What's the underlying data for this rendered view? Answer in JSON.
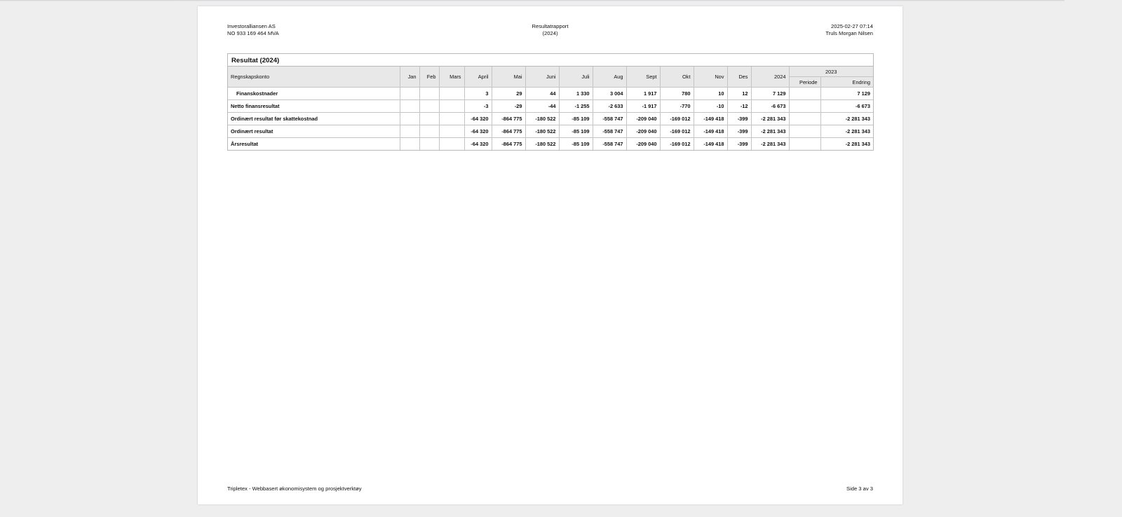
{
  "header": {
    "company": "Investoralliansen AS",
    "org_number": "NO 933 169 464 MVA",
    "report_title": "Resultatrapport",
    "report_year": "(2024)",
    "timestamp": "2025-02-27 07:14",
    "user": "Truls Morgan Nilsen"
  },
  "table": {
    "title": "Resultat (2024)",
    "columns": {
      "account": "Regnskapskonto",
      "jan": "Jan",
      "feb": "Feb",
      "mars": "Mars",
      "april": "April",
      "mai": "Mai",
      "juni": "Juni",
      "juli": "Juli",
      "aug": "Aug",
      "sept": "Sept",
      "okt": "Okt",
      "nov": "Nov",
      "des": "Des",
      "total_2024": "2024",
      "year_2023": "2023",
      "periode": "Periode",
      "endring": "Endring"
    },
    "rows": [
      {
        "label": "Finanskostnader",
        "jan": "",
        "feb": "",
        "mars": "",
        "april": "3",
        "mai": "29",
        "juni": "44",
        "juli": "1 330",
        "aug": "3 004",
        "sept": "1 917",
        "okt": "780",
        "nov": "10",
        "des": "12",
        "total": "7 129",
        "periode": "",
        "endring": "7 129"
      },
      {
        "label": "Netto finansresultat",
        "jan": "",
        "feb": "",
        "mars": "",
        "april": "-3",
        "mai": "-29",
        "juni": "-44",
        "juli": "-1 255",
        "aug": "-2 633",
        "sept": "-1 917",
        "okt": "-770",
        "nov": "-10",
        "des": "-12",
        "total": "-6 673",
        "periode": "",
        "endring": "-6 673"
      },
      {
        "label": "Ordinært resultat før skattekostnad",
        "jan": "",
        "feb": "",
        "mars": "",
        "april": "-64 320",
        "mai": "-864 775",
        "juni": "-180 522",
        "juli": "-85 109",
        "aug": "-558 747",
        "sept": "-209 040",
        "okt": "-169 012",
        "nov": "-149 418",
        "des": "-399",
        "total": "-2 281 343",
        "periode": "",
        "endring": "-2 281 343"
      },
      {
        "label": "Ordinært resultat",
        "jan": "",
        "feb": "",
        "mars": "",
        "april": "-64 320",
        "mai": "-864 775",
        "juni": "-180 522",
        "juli": "-85 109",
        "aug": "-558 747",
        "sept": "-209 040",
        "okt": "-169 012",
        "nov": "-149 418",
        "des": "-399",
        "total": "-2 281 343",
        "periode": "",
        "endring": "-2 281 343"
      },
      {
        "label": "Årsresultat",
        "jan": "",
        "feb": "",
        "mars": "",
        "april": "-64 320",
        "mai": "-864 775",
        "juni": "-180 522",
        "juli": "-85 109",
        "aug": "-558 747",
        "sept": "-209 040",
        "okt": "-169 012",
        "nov": "-149 418",
        "des": "-399",
        "total": "-2 281 343",
        "periode": "",
        "endring": "-2 281 343"
      }
    ]
  },
  "footer": {
    "system": "Tripletex - Webbasert økonomisystem og prosjektverktøy",
    "page": "Side 3 av 3"
  }
}
